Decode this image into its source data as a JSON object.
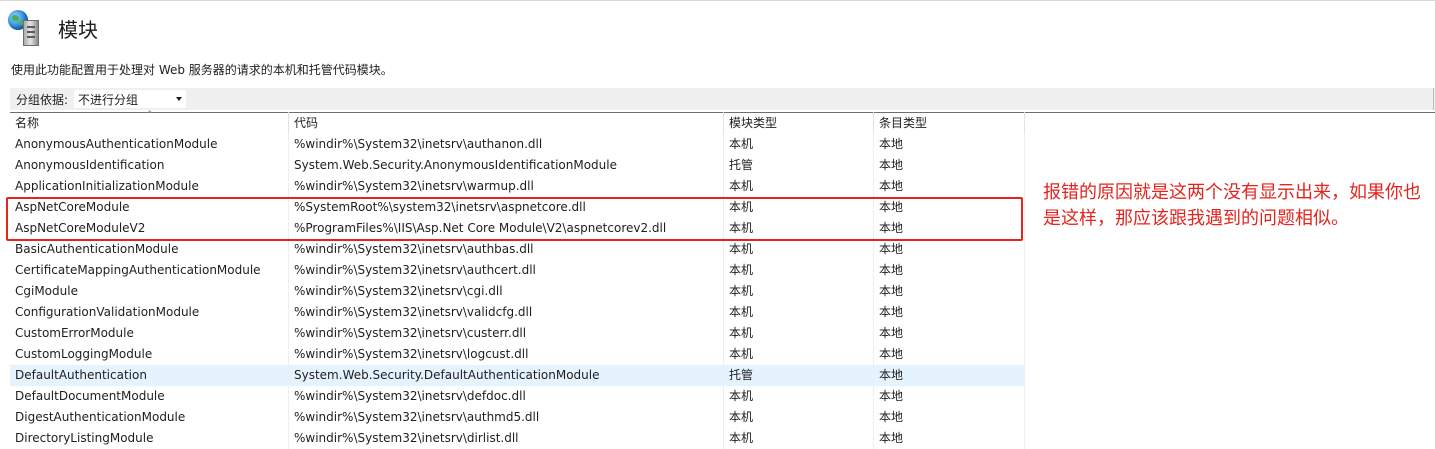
{
  "page": {
    "title": "模块",
    "description": "使用此功能配置用于处理对 Web 服务器的请求的本机和托管代码模块。"
  },
  "groupby": {
    "label": "分组依据:",
    "selected": "不进行分组"
  },
  "table": {
    "headers": [
      "名称",
      "代码",
      "模块类型",
      "条目类型"
    ],
    "rows": [
      [
        "AnonymousAuthenticationModule",
        "%windir%\\System32\\inetsrv\\authanon.dll",
        "本机",
        "本地"
      ],
      [
        "AnonymousIdentification",
        "System.Web.Security.AnonymousIdentificationModule",
        "托管",
        "本地"
      ],
      [
        "ApplicationInitializationModule",
        "%windir%\\System32\\inetsrv\\warmup.dll",
        "本机",
        "本地"
      ],
      [
        "AspNetCoreModule",
        "%SystemRoot%\\system32\\inetsrv\\aspnetcore.dll",
        "本机",
        "本地"
      ],
      [
        "AspNetCoreModuleV2",
        "%ProgramFiles%\\IIS\\Asp.Net Core Module\\V2\\aspnetcorev2.dll",
        "本机",
        "本地"
      ],
      [
        "BasicAuthenticationModule",
        "%windir%\\System32\\inetsrv\\authbas.dll",
        "本机",
        "本地"
      ],
      [
        "CertificateMappingAuthenticationModule",
        "%windir%\\System32\\inetsrv\\authcert.dll",
        "本机",
        "本地"
      ],
      [
        "CgiModule",
        "%windir%\\System32\\inetsrv\\cgi.dll",
        "本机",
        "本地"
      ],
      [
        "ConfigurationValidationModule",
        "%windir%\\System32\\inetsrv\\validcfg.dll",
        "本机",
        "本地"
      ],
      [
        "CustomErrorModule",
        "%windir%\\System32\\inetsrv\\custerr.dll",
        "本机",
        "本地"
      ],
      [
        "CustomLoggingModule",
        "%windir%\\System32\\inetsrv\\logcust.dll",
        "本机",
        "本地"
      ],
      [
        "DefaultAuthentication",
        "System.Web.Security.DefaultAuthenticationModule",
        "托管",
        "本地"
      ],
      [
        "DefaultDocumentModule",
        "%windir%\\System32\\inetsrv\\defdoc.dll",
        "本机",
        "本地"
      ],
      [
        "DigestAuthenticationModule",
        "%windir%\\System32\\inetsrv\\authmd5.dll",
        "本机",
        "本地"
      ],
      [
        "DirectoryListingModule",
        "%windir%\\System32\\inetsrv\\dirlist.dll",
        "本机",
        "本地"
      ]
    ],
    "selected_row": "DefaultAuthentication"
  },
  "annotation": {
    "text": "报错的原因就是这两个没有显示出来，如果你也是这样，那应该跟我遇到的问题相似。"
  },
  "colors": {
    "annotation": "#e3251f",
    "selected_row": "#e5f3ff",
    "toolbar": "#f0f0f0"
  }
}
